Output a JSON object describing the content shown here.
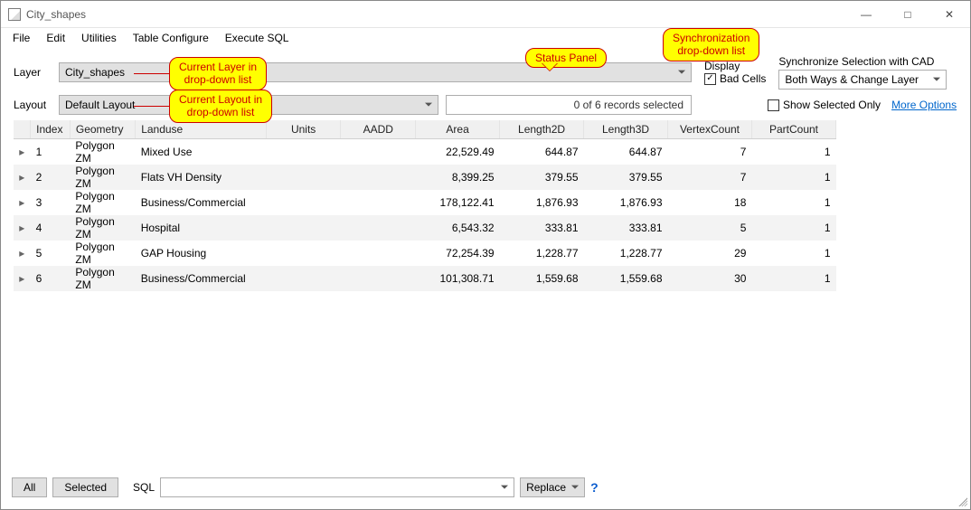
{
  "window": {
    "title": "City_shapes"
  },
  "menu": {
    "items": [
      "File",
      "Edit",
      "Utilities",
      "Table Configure",
      "Execute SQL"
    ]
  },
  "layer": {
    "label": "Layer",
    "value": "City_shapes"
  },
  "layout": {
    "label": "Layout",
    "value": "Default Layout"
  },
  "status": {
    "text": "0 of 6 records selected"
  },
  "display": {
    "group_label": "Display",
    "bad_cells": {
      "label": "Bad Cells",
      "checked": true
    }
  },
  "sync": {
    "label": "Synchronize Selection with CAD",
    "value": "Both Ways & Change Layer",
    "show_selected": {
      "label": "Show Selected Only",
      "checked": false
    },
    "more_options": "More Options"
  },
  "table": {
    "columns": [
      "Index",
      "Geometry",
      "Landuse",
      "Units",
      "AADD",
      "Area",
      "Length2D",
      "Length3D",
      "VertexCount",
      "PartCount"
    ],
    "rows": [
      {
        "index": "1",
        "geometry": "Polygon ZM",
        "landuse": "Mixed Use",
        "units": "",
        "aadd": "",
        "area": "22,529.49",
        "len2d": "644.87",
        "len3d": "644.87",
        "vc": "7",
        "pc": "1"
      },
      {
        "index": "2",
        "geometry": "Polygon ZM",
        "landuse": "Flats VH Density",
        "units": "",
        "aadd": "",
        "area": "8,399.25",
        "len2d": "379.55",
        "len3d": "379.55",
        "vc": "7",
        "pc": "1"
      },
      {
        "index": "3",
        "geometry": "Polygon ZM",
        "landuse": "Business/Commercial",
        "units": "",
        "aadd": "",
        "area": "178,122.41",
        "len2d": "1,876.93",
        "len3d": "1,876.93",
        "vc": "18",
        "pc": "1"
      },
      {
        "index": "4",
        "geometry": "Polygon ZM",
        "landuse": "Hospital",
        "units": "",
        "aadd": "",
        "area": "6,543.32",
        "len2d": "333.81",
        "len3d": "333.81",
        "vc": "5",
        "pc": "1"
      },
      {
        "index": "5",
        "geometry": "Polygon ZM",
        "landuse": "GAP Housing",
        "units": "",
        "aadd": "",
        "area": "72,254.39",
        "len2d": "1,228.77",
        "len3d": "1,228.77",
        "vc": "29",
        "pc": "1"
      },
      {
        "index": "6",
        "geometry": "Polygon ZM",
        "landuse": "Business/Commercial",
        "units": "",
        "aadd": "",
        "area": "101,308.71",
        "len2d": "1,559.68",
        "len3d": "1,559.68",
        "vc": "30",
        "pc": "1"
      }
    ]
  },
  "bottom": {
    "all": "All",
    "selected": "Selected",
    "sql_label": "SQL",
    "sql_value": "",
    "replace": "Replace",
    "help": "?"
  },
  "callouts": {
    "layer": "Current Layer in\ndrop-down list",
    "layout": "Current Layout in\ndrop-down list",
    "status": "Status Panel",
    "sync": "Synchronization\ndrop-down list"
  }
}
